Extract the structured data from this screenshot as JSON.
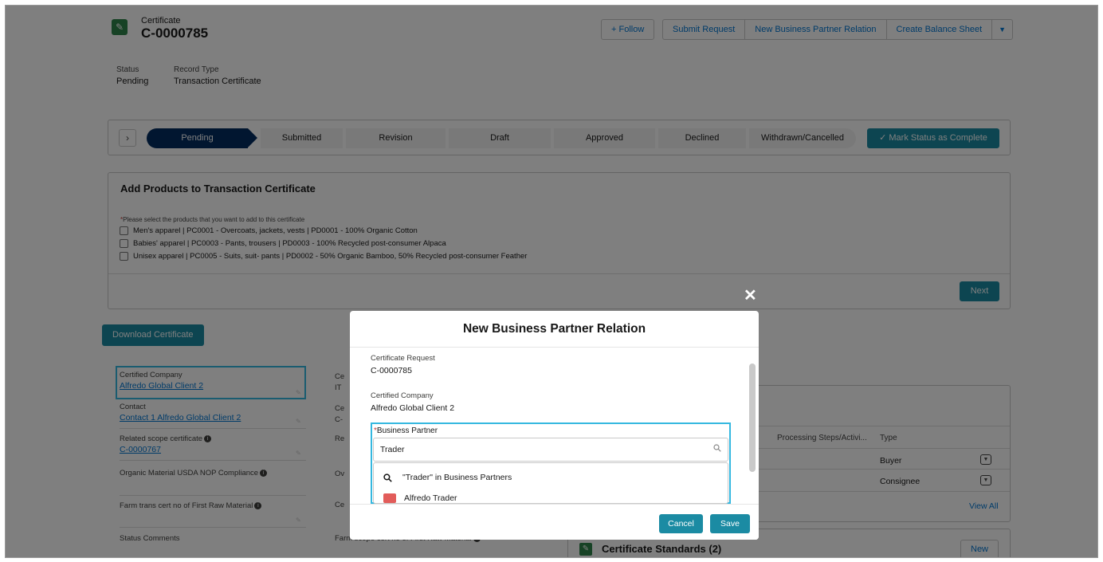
{
  "header": {
    "object_label": "Certificate",
    "record_name": "C-0000785",
    "buttons": {
      "follow": "Follow",
      "submit": "Submit Request",
      "bp_relation": "New Business Partner Relation",
      "balance": "Create Balance Sheet"
    }
  },
  "highlights": {
    "status_label": "Status",
    "status_value": "Pending",
    "record_type_label": "Record Type",
    "record_type_value": "Transaction Certificate"
  },
  "path": {
    "stages": [
      "Pending",
      "Submitted",
      "Revision",
      "Draft",
      "Approved",
      "Declined",
      "Withdrawn/Cancelled"
    ],
    "mark_complete": "Mark Status as Complete"
  },
  "products": {
    "title": "Add Products to Transaction Certificate",
    "note_marker": "*",
    "note": "Please select the products that you want to add to this certificate",
    "items": [
      "Men's apparel | PC0001 - Overcoats, jackets, vests | PD0001 - 100% Organic Cotton",
      "Babies' apparel | PC0003 - Pants, trousers | PD0003 - 100% Recycled post-consumer Alpaca",
      "Unisex apparel | PC0005 - Suits, suit- pants | PD0002 - 50% Organic Bamboo, 50% Recycled post-consumer Feather"
    ],
    "next": "Next"
  },
  "details": {
    "download": "Download Certificate",
    "certified_company_label": "Certified Company",
    "certified_company_value": "Alfredo Global Client 2",
    "contact_label": "Contact",
    "contact_value": "Contact 1 Alfredo Global Client 2",
    "scope_label": "Related scope certificate",
    "scope_value": "C-0000767",
    "usda_label": "Organic Material USDA NOP Compliance",
    "farm_label": "Farm trans cert no of First Raw Material",
    "status_comments_label": "Status Comments",
    "farm_scope_label": "Farm scope cert no of First Raw Material",
    "col2_labels": [
      "Ce",
      "IT",
      "Ce",
      "C-",
      "Re",
      "Ov",
      "Ce"
    ]
  },
  "related": {
    "col_processing": "Processing Steps/Activi...",
    "col_type": "Type",
    "rows": [
      "Buyer",
      "Consignee"
    ],
    "view_all": "View All",
    "standards_title": "Certificate Standards (2)",
    "new": "New"
  },
  "modal": {
    "title": "New Business Partner Relation",
    "cert_request_label": "Certificate Request",
    "cert_request_value": "C-0000785",
    "certified_company_label": "Certified Company",
    "certified_company_value": "Alfredo Global Client 2",
    "bp_required": "*",
    "bp_label": "Business Partner",
    "bp_input": "Trader",
    "search_option": "\"Trader\" in Business Partners",
    "result": "Alfredo Trader",
    "cancel": "Cancel",
    "save": "Save",
    "close": "✕"
  },
  "colors": {
    "brand": "#1b8ba3",
    "path_current": "#032d60",
    "highlight": "#35b8e0"
  }
}
